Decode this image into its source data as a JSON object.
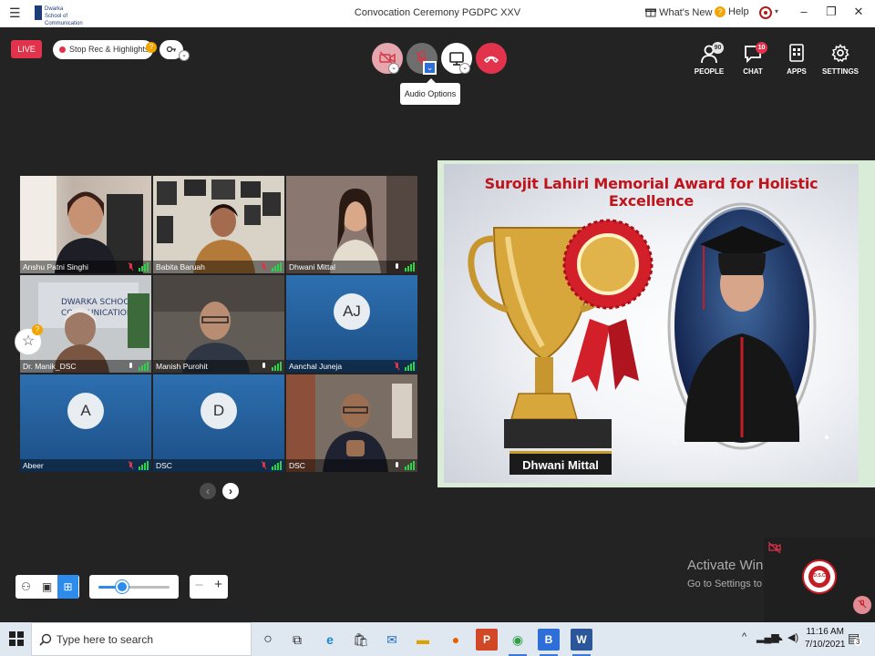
{
  "window": {
    "title": "Convocation Ceremony PGDPC XXV",
    "logo_text": "Dwarka School of Communication",
    "whats_new": "What's New",
    "help": "Help"
  },
  "topbar": {
    "live": "LIVE",
    "stop_rec": "Stop Rec & Highlights",
    "stop_rec_badge": "?",
    "audio_tooltip": "Audio Options"
  },
  "right_tools": [
    {
      "label": "PEOPLE",
      "badge": "90",
      "icon": "people-icon"
    },
    {
      "label": "CHAT",
      "badge": "10",
      "icon": "chat-icon"
    },
    {
      "label": "APPS",
      "badge": "",
      "icon": "apps-icon"
    },
    {
      "label": "SETTINGS",
      "badge": "",
      "icon": "gear-icon"
    }
  ],
  "participants": [
    {
      "name": "Anshu Patni Singhi",
      "muted": true
    },
    {
      "name": "Babita Baruah",
      "muted": true
    },
    {
      "name": "Dhwani Mittal",
      "muted": false
    },
    {
      "name": "Dr. Manik_DSC",
      "muted": false
    },
    {
      "name": "Manish Purohit",
      "muted": false
    },
    {
      "name": "Aanchal Juneja",
      "muted": true,
      "initials": "AJ"
    },
    {
      "name": "Abeer",
      "muted": true,
      "initials": "A"
    },
    {
      "name": "DSC",
      "muted": true,
      "initials": "D"
    },
    {
      "name": "DSC",
      "muted": false
    }
  ],
  "star_badge": "?",
  "presentation": {
    "title": "Surojit Lahiri Memorial Award for Holistic Excellence",
    "winner": "Dhwani Mittal"
  },
  "watermark": {
    "line1": "Activate Windows",
    "line2": "Go to Settings to activate Windows."
  },
  "selfview": {
    "logo_text": "D.S.C"
  },
  "taskbar": {
    "search_placeholder": "Type here to search",
    "time": "11:16 AM",
    "date": "7/10/2021",
    "notifications": "3"
  },
  "colors": {
    "live": "#e2334c",
    "accent": "#2d8ceb",
    "hangup": "#e2334c",
    "award_title": "#c0141c",
    "active_speaker": "#2dd14a"
  }
}
